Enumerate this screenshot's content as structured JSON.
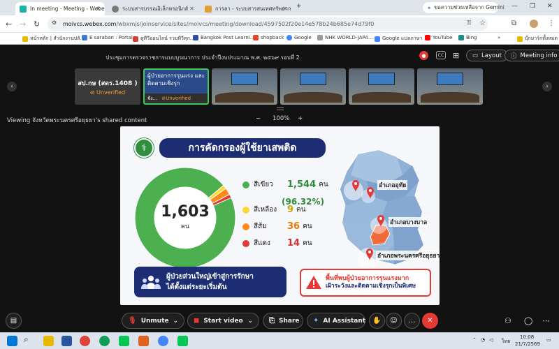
{
  "browser": {
    "tabs": [
      {
        "title": "In meeting - Meeting - Webe",
        "active": true
      },
      {
        "title": "ระบบสารบรรณอิเล็กทรอนิกส์",
        "active": false
      },
      {
        "title": "การลา - ระบบสารสนเทศทรัพยากรบุ",
        "active": false
      }
    ],
    "gemini_button": "ขอความช่วยเหลือจาก Gemini",
    "url_host": "moivcs.webex.com",
    "url_path": "/wbxmjs/joinservice/sites/moivcs/meeting/download/4597502f20e14e578b24b685e74d79f0",
    "bookmarks": [
      "หน้าหลัก | สำนักงานปลั...",
      "E saraban : Portal",
      "ดูทีวีออนไลน์ รวมทีวีทุก...",
      "Bangkok Post Learni...",
      "shopback",
      "Google",
      "NHK WORLD-JAPA...",
      "Google แปลภาษา",
      "YouTube",
      "Bing"
    ],
    "bookmarks_overflow": "»",
    "all_bookmarks": "บุ๊กมาร์กทั้งหมด"
  },
  "meeting": {
    "title": "ประชุมการตรวจราชการแบบบูรณาการ ประจำปีงบประมาณ พ.ศ. ๒๕๖๙ รอบที่ 2",
    "cc_label": "CC",
    "layout_label": "Layout",
    "info_label": "Meeting info",
    "participants": [
      {
        "name": "สป.กษ (สดร.1408 )",
        "status": "Unverified"
      },
      {
        "name": "จัง...",
        "status": "Unverified"
      }
    ],
    "selected_header": "ผู้ป่วยอาการรุนแรง และติดตามเชิงรุก",
    "viewing_text": "Viewing จังหวัดพระนครศรีอยุธยา's shared content",
    "zoom_minus": "−",
    "zoom_level": "100%",
    "zoom_plus": "+"
  },
  "slide": {
    "title": "การคัดกรองผู้ใช้ยาเสพติด",
    "total": "1,603",
    "total_unit": "คน",
    "categories": [
      {
        "name": "สีเขียว",
        "value": "1,544",
        "unit": "คน",
        "count": 1544,
        "color": "#4caf50"
      },
      {
        "name": "สีเหลือง",
        "value": "9",
        "unit": "คน",
        "count": 9,
        "color": "#fdd835"
      },
      {
        "name": "สีส้ม",
        "value": "36",
        "unit": "คน",
        "count": 36,
        "color": "#ff8c1a"
      },
      {
        "name": "สีแดง",
        "value": "14",
        "unit": "คน",
        "count": 14,
        "color": "#e53935"
      }
    ],
    "green_percent": "(96.32%)",
    "map_labels": [
      "อำเภออุทัย",
      "อำเภอบางบาล",
      "อำเภอพระนครศรีอยุธยา"
    ],
    "left_box_line1": "ผู้ป่วยส่วนใหญ่เข้าสู่การรักษา",
    "left_box_line2": "ได้ตั้งแต่ระยะเริ่มต้น",
    "right_box_line1": "พื้นที่พบผู้ป่วยอาการรุนแรงมาก",
    "right_box_line2": "เฝ้าระวังและติดตามเชิงรุกเป็นพิเศษ"
  },
  "controls": {
    "mute": "Unmute",
    "video": "Start video",
    "share": "Share",
    "ai": "AI Assistant"
  },
  "taskbar": {
    "lang": "ไทย",
    "time": "10:08",
    "date": "21/7/2569"
  },
  "colors": {
    "accent_green": "#3cc85a",
    "end_red": "#e53935",
    "slide_navy": "#1c2d73"
  }
}
